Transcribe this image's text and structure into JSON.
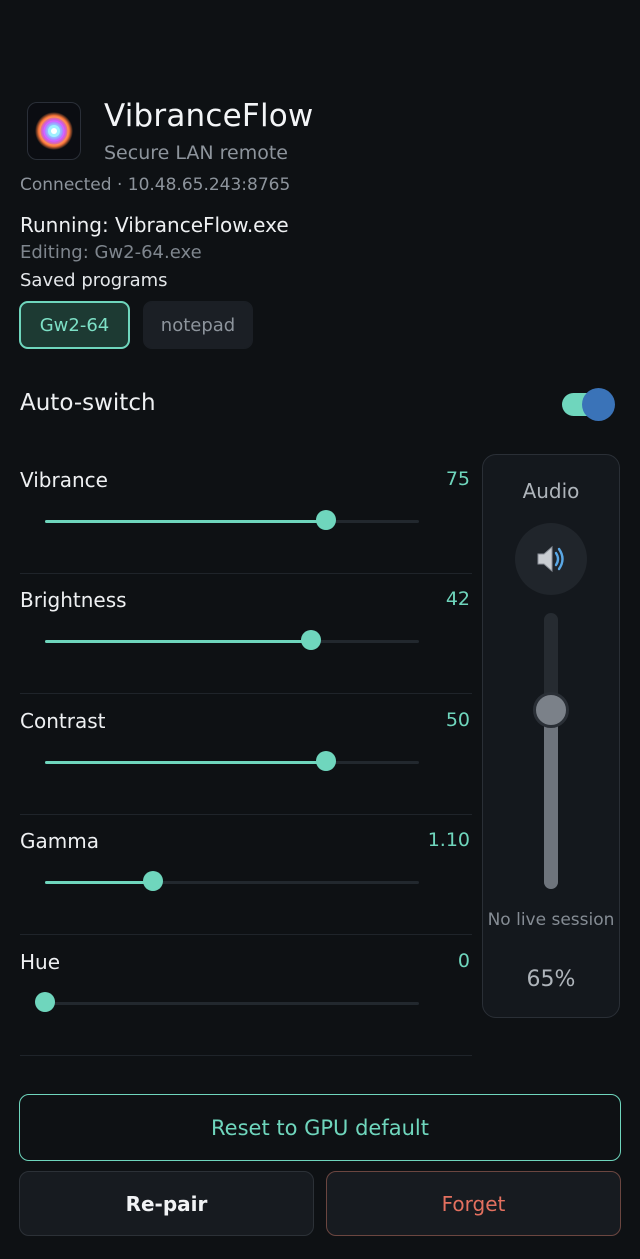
{
  "header": {
    "title": "VibranceFlow",
    "subtitle": "Secure LAN remote",
    "connection": "Connected · 10.48.65.243:8765",
    "running": "Running: VibranceFlow.exe",
    "editing": "Editing: Gw2-64.exe",
    "icon": "app-logo-icon"
  },
  "saved_programs": {
    "label": "Saved programs",
    "items": [
      {
        "label": "Gw2-64",
        "active": true
      },
      {
        "label": "notepad",
        "active": false
      }
    ]
  },
  "auto_switch": {
    "label": "Auto-switch",
    "enabled": true
  },
  "sliders": [
    {
      "label": "Vibrance",
      "value": "75",
      "fraction": 0.75
    },
    {
      "label": "Brightness",
      "value": "42",
      "fraction": 0.71
    },
    {
      "label": "Contrast",
      "value": "50",
      "fraction": 0.75
    },
    {
      "label": "Gamma",
      "value": "1.10",
      "fraction": 0.29
    },
    {
      "label": "Hue",
      "value": "0",
      "fraction": 0.0
    }
  ],
  "audio": {
    "title": "Audio",
    "icon": "speaker-icon",
    "status": "No live session",
    "percent": "65%",
    "level": 0.65
  },
  "actions": {
    "reset": "Reset to GPU default",
    "repair": "Re-pair",
    "forget": "Forget"
  },
  "colors": {
    "accent": "#6fd6bd",
    "background": "#0e1114",
    "danger": "#e3705f",
    "toggle_knob": "#3a73b8"
  }
}
